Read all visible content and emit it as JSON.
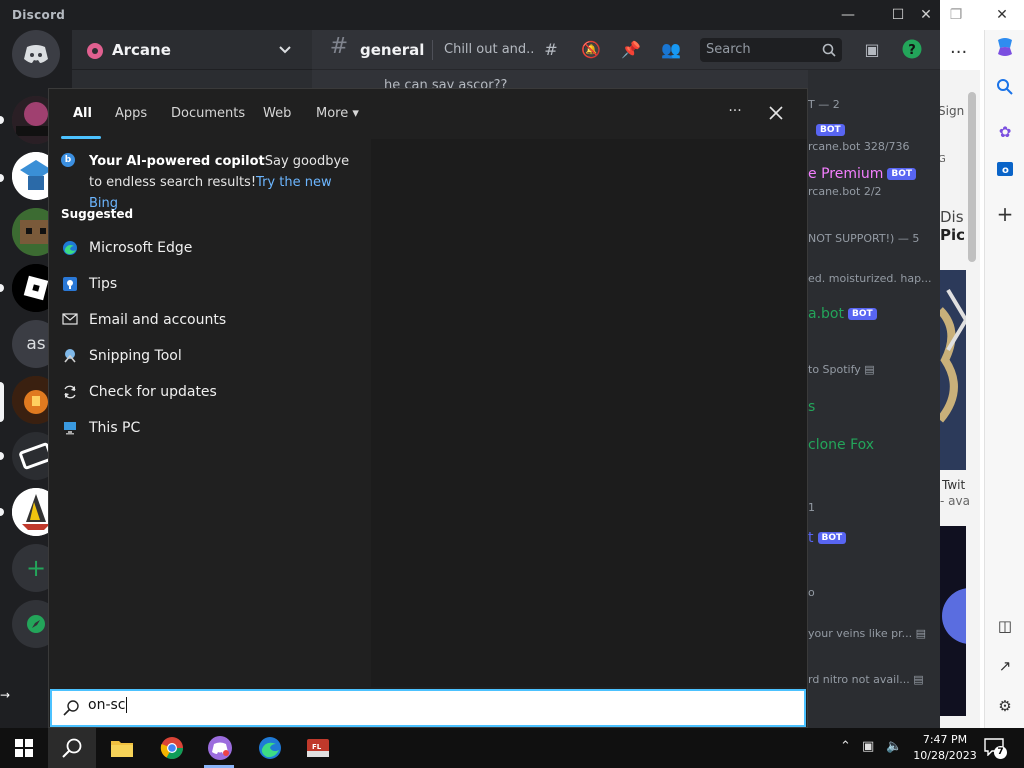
{
  "discord": {
    "app_name": "Discord",
    "server_name": "Arcane",
    "channel_name": "general",
    "channel_topic": "Chill out and..",
    "search_placeholder": "Search",
    "rail_label_as": "as",
    "chat_partial": "he can say ascor??",
    "members": [
      "T — 2",
      "BOT",
      "rcane.bot 328/736",
      "e Premium",
      "BOT",
      "rcane.bot 2/2",
      "NOT SUPPORT!) — 5",
      "ed. moisturized. hap...",
      "a.bot",
      "BOT",
      "to Spotify",
      "s",
      "clone Fox",
      "1",
      "t",
      "BOT",
      "o",
      "your veins like pr...",
      "rd nitro not avail..."
    ]
  },
  "edge": {
    "sign": "Sign",
    "g": "G",
    "dis": "Dis",
    "pic": "Pic",
    "twit": "Twit",
    "ava": "- ava"
  },
  "search_flyout": {
    "tabs": [
      "All",
      "Apps",
      "Documents",
      "Web",
      "More"
    ],
    "more_options": "···",
    "bing": {
      "title": "Your AI-powered copilot",
      "subtitle": "Say goodbye to endless search results!",
      "link": "Try the new Bing"
    },
    "section_label": "Suggested",
    "suggested": [
      {
        "label": "Microsoft Edge",
        "icon": "edge-icon"
      },
      {
        "label": "Tips",
        "icon": "tips-icon"
      },
      {
        "label": "Email and accounts",
        "icon": "mail-icon"
      },
      {
        "label": "Snipping Tool",
        "icon": "snipping-tool-icon"
      },
      {
        "label": "Check for updates",
        "icon": "refresh-icon"
      },
      {
        "label": "This PC",
        "icon": "computer-icon"
      }
    ],
    "query": "on-sc"
  },
  "taskbar": {
    "time": "7:47 PM",
    "date": "10/28/2023",
    "notification_count": "7"
  },
  "colors": {
    "accent": "#4cc2ff",
    "discord_blurple": "#5865f2",
    "discord_green": "#23a55a"
  }
}
